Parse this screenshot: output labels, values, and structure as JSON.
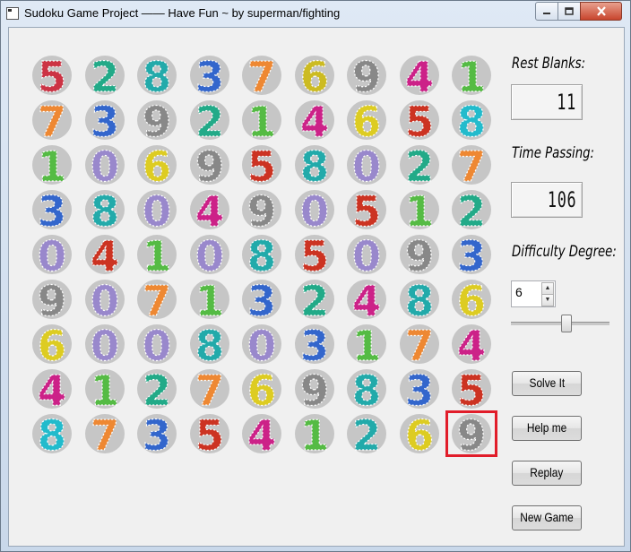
{
  "window": {
    "title": "Sudoku Game Project —— Have Fun ~ by superman/fighting"
  },
  "titlebar_icons": {
    "minimize": "minimize-icon",
    "maximize": "maximize-icon",
    "close": "close-icon"
  },
  "board": {
    "rows": [
      [
        5,
        2,
        8,
        3,
        7,
        6,
        9,
        4,
        1
      ],
      [
        7,
        3,
        9,
        2,
        1,
        4,
        6,
        5,
        8
      ],
      [
        1,
        0,
        6,
        9,
        5,
        8,
        0,
        2,
        7
      ],
      [
        3,
        8,
        0,
        4,
        9,
        0,
        5,
        1,
        2
      ],
      [
        0,
        4,
        1,
        0,
        8,
        5,
        0,
        9,
        3
      ],
      [
        9,
        0,
        7,
        1,
        3,
        2,
        4,
        8,
        6
      ],
      [
        6,
        0,
        0,
        8,
        0,
        3,
        1,
        7,
        4
      ],
      [
        4,
        1,
        2,
        7,
        6,
        9,
        8,
        3,
        5
      ],
      [
        8,
        7,
        3,
        5,
        4,
        1,
        2,
        6,
        9
      ]
    ],
    "colors": [
      [
        "#cc3344",
        "#22aa88",
        "#22aaaa",
        "#3366cc",
        "#ee8833",
        "#ccbb22",
        "#888888",
        "#cc2288",
        "#55bb44"
      ],
      [
        "#ee8833",
        "#3366cc",
        "#888888",
        "#22aa88",
        "#55bb44",
        "#cc2288",
        "#ddcc22",
        "#cc3322",
        "#22bbcc"
      ],
      [
        "#55bb44",
        "#9988cc",
        "#ddcc22",
        "#888888",
        "#cc3322",
        "#22aaaa",
        "#9988cc",
        "#22aa88",
        "#ee8833"
      ],
      [
        "#3366cc",
        "#22aaaa",
        "#9988cc",
        "#cc2288",
        "#888888",
        "#9988cc",
        "#cc3322",
        "#55bb44",
        "#22aa88"
      ],
      [
        "#9988cc",
        "#cc3322",
        "#55bb44",
        "#9988cc",
        "#22aaaa",
        "#cc3322",
        "#9988cc",
        "#888888",
        "#3366cc"
      ],
      [
        "#888888",
        "#9988cc",
        "#ee8833",
        "#55bb44",
        "#3366cc",
        "#22aa88",
        "#cc2288",
        "#22aaaa",
        "#ddcc22"
      ],
      [
        "#ddcc22",
        "#9988cc",
        "#9988cc",
        "#22aaaa",
        "#9988cc",
        "#3366cc",
        "#55bb44",
        "#ee8833",
        "#cc2288"
      ],
      [
        "#cc2288",
        "#55bb44",
        "#22aa88",
        "#ee8833",
        "#ddcc22",
        "#888888",
        "#22aaaa",
        "#3366cc",
        "#cc3322"
      ],
      [
        "#22bbcc",
        "#ee8833",
        "#3366cc",
        "#cc3322",
        "#cc2288",
        "#55bb44",
        "#22aaaa",
        "#ddcc22",
        "#888888"
      ]
    ],
    "selected_cell": [
      8,
      8
    ]
  },
  "panel": {
    "rest_blanks_label": "Rest Blanks:",
    "rest_blanks_value": "11",
    "time_passing_label": "Time Passing:",
    "time_passing_value": "106",
    "difficulty_label": "Difficulty Degree:",
    "difficulty_value": "6",
    "difficulty_min": 1,
    "difficulty_max": 10,
    "buttons": {
      "solve": "Solve It",
      "help": "Help me",
      "replay": "Replay",
      "new_game": "New Game"
    }
  }
}
